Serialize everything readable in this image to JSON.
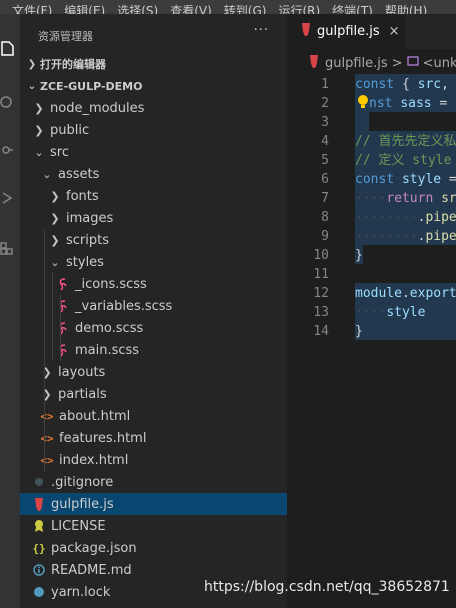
{
  "menubar": [
    "文件(F)",
    "编辑(E)",
    "选择(S)",
    "查看(V)",
    "转到(G)",
    "运行(R)",
    "终端(T)",
    "帮助(H)"
  ],
  "activity_icons": [
    "files-icon",
    "search-icon",
    "source-control-icon",
    "run-debug-icon",
    "extensions-icon"
  ],
  "sidebar": {
    "title": "资源管理器",
    "more": "···",
    "open_editors": "打开的编辑器",
    "workspace": "ZCE-GULP-DEMO",
    "tree": [
      {
        "label": "node_modules",
        "type": "folder",
        "open": false,
        "depth": 1
      },
      {
        "label": "public",
        "type": "folder",
        "open": false,
        "depth": 1
      },
      {
        "label": "src",
        "type": "folder",
        "open": true,
        "depth": 1
      },
      {
        "label": "assets",
        "type": "folder",
        "open": true,
        "depth": 2
      },
      {
        "label": "fonts",
        "type": "folder",
        "open": false,
        "depth": 3
      },
      {
        "label": "images",
        "type": "folder",
        "open": false,
        "depth": 3
      },
      {
        "label": "scripts",
        "type": "folder",
        "open": false,
        "depth": 3
      },
      {
        "label": "styles",
        "type": "folder",
        "open": true,
        "depth": 3
      },
      {
        "label": "_icons.scss",
        "type": "scss",
        "depth": 4
      },
      {
        "label": "_variables.scss",
        "type": "scss",
        "depth": 4
      },
      {
        "label": "demo.scss",
        "type": "scss",
        "depth": 4
      },
      {
        "label": "main.scss",
        "type": "scss",
        "depth": 4
      },
      {
        "label": "layouts",
        "type": "folder",
        "open": false,
        "depth": 2
      },
      {
        "label": "partials",
        "type": "folder",
        "open": false,
        "depth": 2
      },
      {
        "label": "about.html",
        "type": "html",
        "depth": 2
      },
      {
        "label": "features.html",
        "type": "html",
        "depth": 2
      },
      {
        "label": "index.html",
        "type": "html",
        "depth": 2
      },
      {
        "label": ".gitignore",
        "type": "git",
        "depth": 1
      },
      {
        "label": "gulpfile.js",
        "type": "gulp",
        "depth": 1,
        "selected": true
      },
      {
        "label": "LICENSE",
        "type": "license",
        "depth": 1
      },
      {
        "label": "package.json",
        "type": "json",
        "depth": 1
      },
      {
        "label": "README.md",
        "type": "readme",
        "depth": 1
      },
      {
        "label": "yarn.lock",
        "type": "yarn",
        "depth": 1
      }
    ]
  },
  "tab": {
    "label": "gulpfile.js",
    "close": "×"
  },
  "breadcrumb": {
    "file": "gulpfile.js",
    "sep": ">",
    "symbol": "<unknown>"
  },
  "editor": {
    "line_numbers": [
      "1",
      "2",
      "3",
      "4",
      "5",
      "6",
      "7",
      "8",
      "9",
      "10",
      "11",
      "12",
      "13",
      "14"
    ],
    "lines": [
      [
        [
          "kw",
          "const"
        ],
        [
          "pl",
          " { "
        ],
        [
          "id",
          "src"
        ],
        [
          "pl",
          ", "
        ]
      ],
      [
        [
          "kw",
          "nst"
        ],
        [
          "pl",
          " "
        ],
        [
          "id",
          "sass"
        ],
        [
          "pl",
          " ="
        ]
      ],
      [],
      [
        [
          "cm",
          "// 首先先定义私"
        ]
      ],
      [
        [
          "cm",
          "// 定义 style"
        ]
      ],
      [
        [
          "kw",
          "const"
        ],
        [
          "pl",
          " "
        ],
        [
          "id",
          "style"
        ],
        [
          "pl",
          " ="
        ]
      ],
      [
        [
          "ws",
          "····"
        ],
        [
          "kw2",
          "return"
        ],
        [
          "pl",
          " "
        ],
        [
          "fn",
          "sr"
        ]
      ],
      [
        [
          "ws",
          "········"
        ],
        [
          "pl",
          "."
        ],
        [
          "fn",
          "pipe"
        ]
      ],
      [
        [
          "ws",
          "········"
        ],
        [
          "pl",
          "."
        ],
        [
          "fn",
          "pipe"
        ]
      ],
      [
        [
          "pl",
          "}"
        ]
      ],
      [],
      [
        [
          "id",
          "module"
        ],
        [
          "pl",
          "."
        ],
        [
          "id",
          "export"
        ]
      ],
      [
        [
          "ws",
          "····"
        ],
        [
          "id",
          "style"
        ]
      ],
      [
        [
          "pl",
          "}"
        ]
      ]
    ]
  },
  "colors": {
    "folder": "#c5c5c5",
    "scss": "#f55385",
    "html": "#e37933",
    "git": "#41535b",
    "gulp": "#db4446",
    "license": "#cbcb41",
    "json": "#cbcb41",
    "readme": "#519aba",
    "yarn": "#519aba",
    "selection": "#094771"
  },
  "watermark": "https://blog.csdn.net/qq_38652871"
}
